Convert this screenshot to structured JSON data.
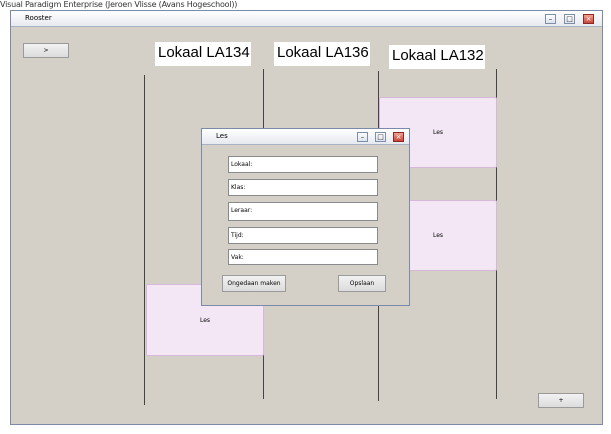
{
  "app_caption": "Visual Paradigm Enterprise (Jeroen Vlisse (Avans Hogeschool))",
  "window": {
    "title": "Rooster",
    "min_label": "–",
    "max_label": "□",
    "close_label": "×"
  },
  "toolbar": {
    "prev_label": ">",
    "add_label": "+"
  },
  "rooms": [
    {
      "name": "Lokaal LA134"
    },
    {
      "name": "Lokaal LA136"
    },
    {
      "name": "Lokaal LA132"
    }
  ],
  "lessons": [
    {
      "label": "Les"
    },
    {
      "label": "Les"
    },
    {
      "label": "Les"
    }
  ],
  "dialog": {
    "title": "Les",
    "fields": [
      {
        "value": "Lokaal:"
      },
      {
        "value": "Klas:"
      },
      {
        "value": "Leraar:"
      },
      {
        "value": "Tijd:"
      },
      {
        "value": "Vak:"
      }
    ],
    "undo_label": "Ongedaan maken",
    "save_label": "Opslaan"
  },
  "colors": {
    "lesson_fill": "#f3e7f5",
    "window_bg": "#d4d0c8"
  }
}
